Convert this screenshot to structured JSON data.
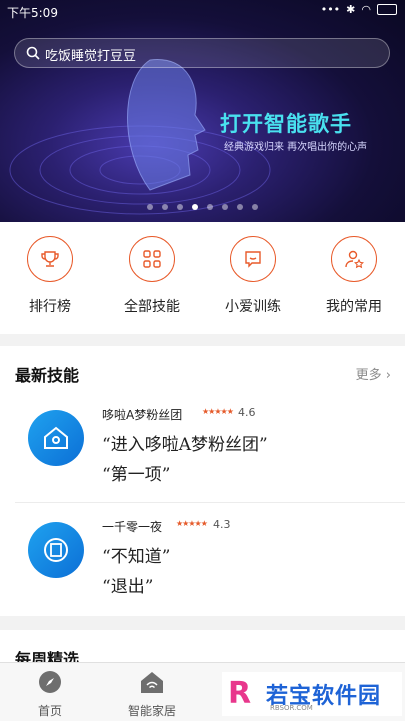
{
  "status": {
    "time": "下午5:09"
  },
  "search": {
    "text": "吃饭睡觉打豆豆"
  },
  "banner": {
    "title": "打开智能歌手",
    "subtitle": "经典游戏归来 再次唱出你的心声",
    "dot_count": 8,
    "active_dot": 3
  },
  "quick_actions": [
    {
      "label": "排行榜",
      "icon": "trophy-icon"
    },
    {
      "label": "全部技能",
      "icon": "grid-icon"
    },
    {
      "label": "小爱训练",
      "icon": "chat-icon"
    },
    {
      "label": "我的常用",
      "icon": "user-star-icon"
    }
  ],
  "skills": {
    "title": "最新技能",
    "more": "更多",
    "items": [
      {
        "name": "哆啦A梦粉丝团",
        "rating": "4.6",
        "phrases": [
          "“进入哆啦A梦粉丝团”",
          "“第一项”"
        ]
      },
      {
        "name": "一千零一夜",
        "rating": "4.3",
        "phrases": [
          "“不知道”",
          "“退出”"
        ]
      }
    ]
  },
  "weekly": {
    "title": "每周精选"
  },
  "tabs": [
    {
      "label": "首页",
      "icon": "compass-icon"
    },
    {
      "label": "智能家居",
      "icon": "home-wifi-icon"
    }
  ],
  "watermark": {
    "logo": "R",
    "text": "若宝软件园",
    "sub": "RBSOR.COM"
  },
  "colors": {
    "accent": "#e85a2a",
    "promo": "#49e1ef",
    "skill_blue": "#1fa2ef"
  }
}
